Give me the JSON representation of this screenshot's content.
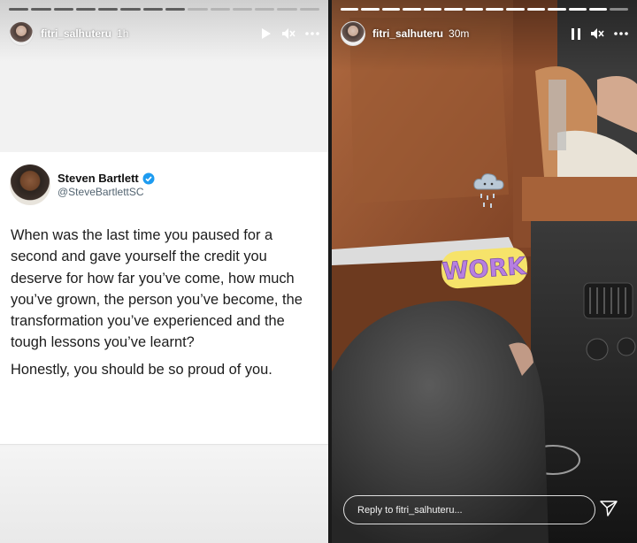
{
  "left_story": {
    "username": "fitri_salhuteru",
    "time": "1h",
    "progress_total": 14,
    "progress_done": 8,
    "tweet": {
      "author_name": "Steven Bartlett",
      "author_handle": "@SteveBartlettSC",
      "verified": true,
      "paragraphs": [
        "When was the last time you paused for a second and gave yourself the credit you deserve for how far you’ve come, how much you’ve grown, the person you’ve become, the transformation you’ve experienced and the tough lessons you’ve learnt?",
        "Honestly, you should be so proud of you."
      ]
    }
  },
  "right_story": {
    "username": "fitri_salhuteru",
    "time": "30m",
    "progress_total": 14,
    "progress_done": 13,
    "stickers": {
      "cloud_icon": "rain-cloud-icon",
      "work_text": "WORK"
    },
    "reply_placeholder": "Reply to fitri_salhuteru..."
  },
  "colors": {
    "verified_blue": "#1d9bf0",
    "leather": "#9c5a35",
    "work_text": "#b77fe0",
    "work_outline": "#f6e36a"
  }
}
